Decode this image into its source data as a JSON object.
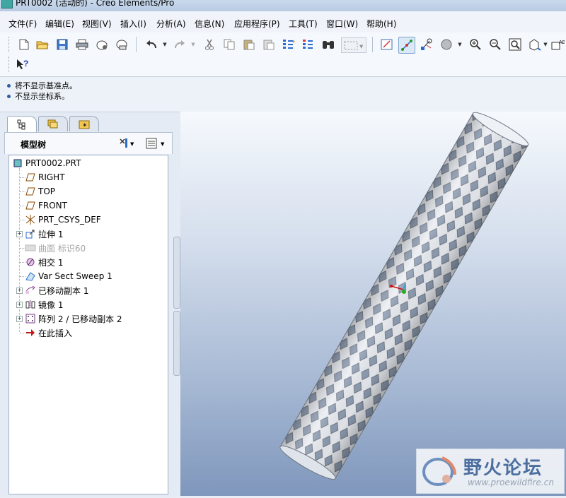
{
  "window": {
    "title": "PRT0002 (活动的) - Creo Elements/Pro"
  },
  "menu": [
    "文件(F)",
    "编辑(E)",
    "视图(V)",
    "插入(I)",
    "分析(A)",
    "信息(N)",
    "应用程序(P)",
    "工具(T)",
    "窗口(W)",
    "帮助(H)"
  ],
  "toolbar": {
    "row1_icons": [
      "new-icon",
      "open-icon",
      "save-icon",
      "print-icon",
      "send-icon",
      "mail-icon",
      "undo-icon",
      "redo-icon",
      "cut-icon",
      "copy-icon",
      "paste-icon",
      "paste-special-icon",
      "regenerate-icon",
      "regenerate-manager-icon",
      "find-icon",
      "select-box-icon",
      "repaint-icon",
      "spin-center-icon",
      "orient-icon",
      "shade-icon",
      "zoom-in-icon",
      "zoom-out-icon",
      "refit-icon",
      "view-manager-icon",
      "annotation-icon"
    ],
    "row2_icons": [
      "context-help-icon"
    ]
  },
  "messages": [
    "将不显示基准点。",
    "不显示坐标系。"
  ],
  "model_tree": {
    "title": "模型树",
    "tabs": [
      "model-tree-tab-icon",
      "layer-tab-icon",
      "favorites-tab-icon"
    ],
    "nodes": [
      {
        "label": "PRT0002.PRT",
        "icon": "part-icon",
        "dim": false,
        "expandable": false
      },
      {
        "label": "RIGHT",
        "icon": "datum-plane-icon",
        "dim": false,
        "expandable": false
      },
      {
        "label": "TOP",
        "icon": "datum-plane-icon",
        "dim": false,
        "expandable": false
      },
      {
        "label": "FRONT",
        "icon": "datum-plane-icon",
        "dim": false,
        "expandable": false
      },
      {
        "label": "PRT_CSYS_DEF",
        "icon": "csys-icon",
        "dim": false,
        "expandable": false
      },
      {
        "label": "拉伸 1",
        "icon": "extrude-icon",
        "dim": false,
        "expandable": true
      },
      {
        "label": "曲面 标识60",
        "icon": "surface-icon",
        "dim": true,
        "expandable": false
      },
      {
        "label": "相交 1",
        "icon": "intersect-icon",
        "dim": false,
        "expandable": false
      },
      {
        "label": "Var Sect Sweep 1",
        "icon": "sweep-icon",
        "dim": false,
        "expandable": false
      },
      {
        "label": "已移动副本 1",
        "icon": "moved-copy-icon",
        "dim": false,
        "expandable": true
      },
      {
        "label": "镜像 1",
        "icon": "mirror-icon",
        "dim": false,
        "expandable": true
      },
      {
        "label": "阵列 2 / 已移动副本 2",
        "icon": "pattern-icon",
        "dim": false,
        "expandable": true
      },
      {
        "label": "在此插入",
        "icon": "insert-here-arrow-icon",
        "dim": false,
        "expandable": false
      }
    ]
  },
  "watermark": {
    "text": "野火论坛",
    "url": "www.proewildfire.cn"
  },
  "colors": {
    "accent": "#2c5da8",
    "viewport_top": "#f6f9fd",
    "viewport_bottom": "#7f97bc"
  }
}
